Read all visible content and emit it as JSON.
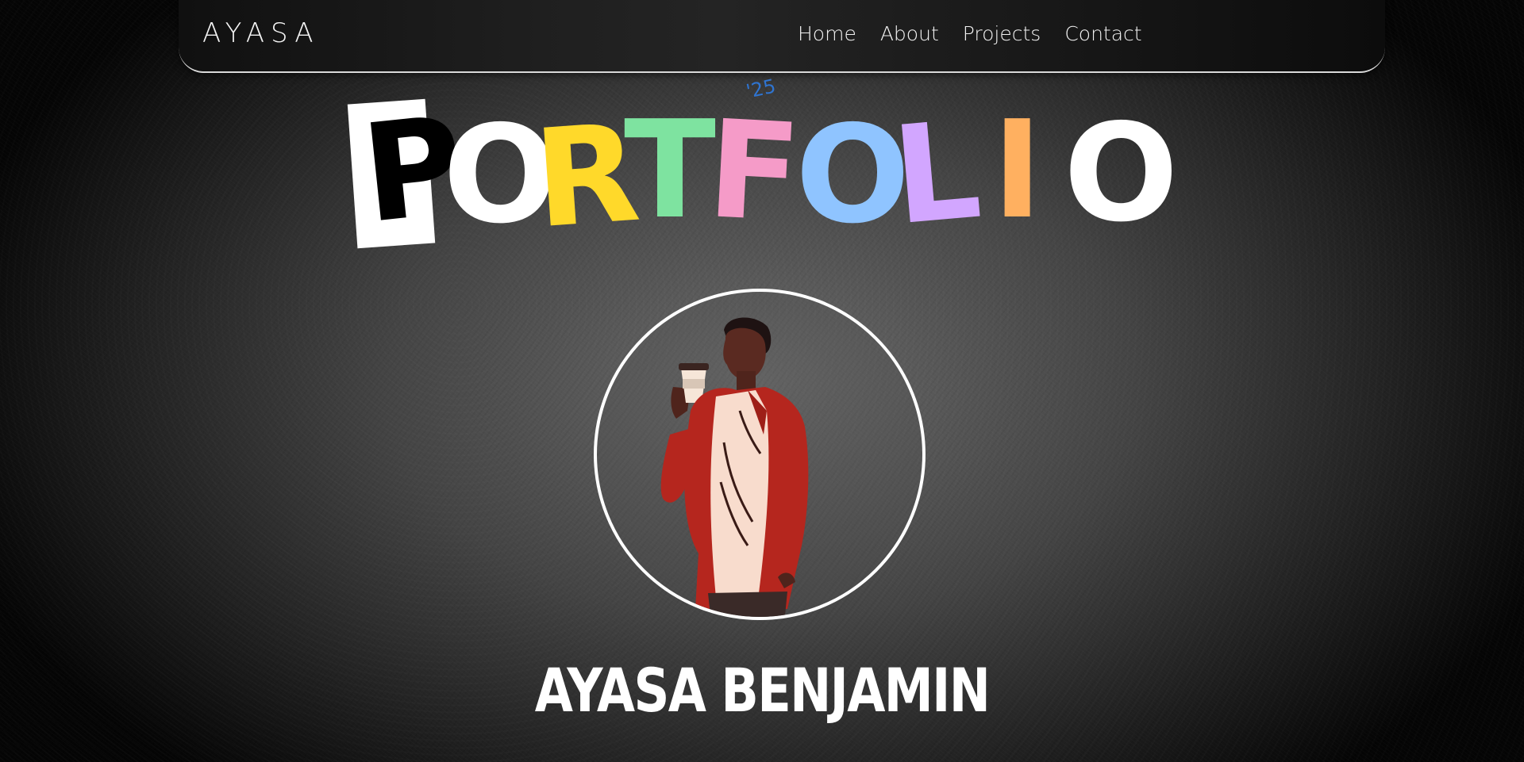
{
  "nav": {
    "logo": "AYASA",
    "items": [
      {
        "label": "Home"
      },
      {
        "label": "About"
      },
      {
        "label": "Projects"
      },
      {
        "label": "Contact"
      }
    ]
  },
  "hero": {
    "title_letters": [
      {
        "char": "P",
        "color": "#000000"
      },
      {
        "char": "O",
        "color": "#ffffff"
      },
      {
        "char": "R",
        "color": "#ffd92a"
      },
      {
        "char": "T",
        "color": "#7ee3a0"
      },
      {
        "char": "F",
        "color": "#f59bc8"
      },
      {
        "char": "O",
        "color": "#8fc4ff"
      },
      {
        "char": "L",
        "color": "#d2a6ff"
      },
      {
        "char": "I",
        "color": "#ffb060"
      },
      {
        "char": "O",
        "color": "#ffffff"
      }
    ],
    "year_tag": "'25",
    "name": "AYASA BENJAMIN",
    "avatar_icon": "person-with-coffee-illustration"
  },
  "colors": {
    "accent_blue": "#2f74d0",
    "nav_border": "#d9d9d9"
  }
}
